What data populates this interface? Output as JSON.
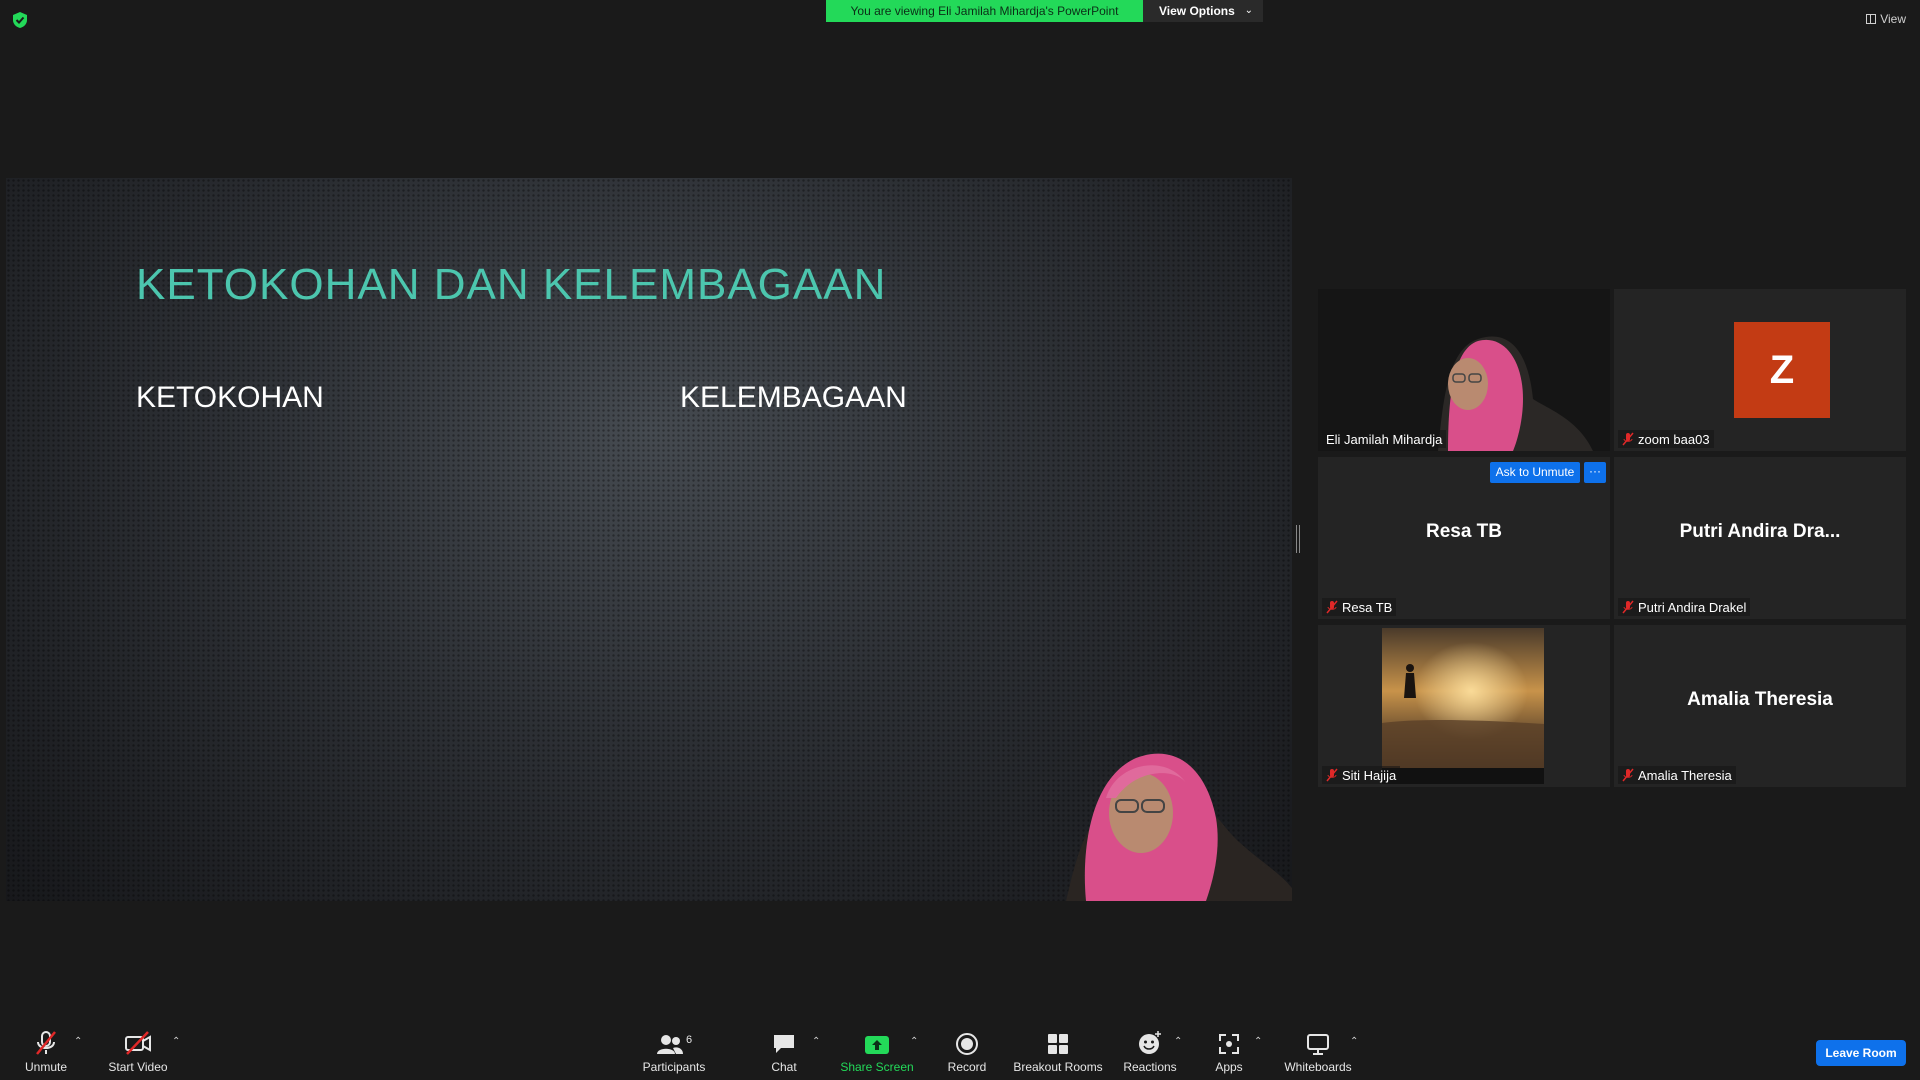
{
  "topbar": {
    "viewing_banner": "You are viewing Eli Jamilah Mihardja's PowerPoint",
    "view_options_label": "View Options",
    "view_label": "View"
  },
  "slide": {
    "title": "KETOKOHAN DAN KELEMBAGAAN",
    "col_left": "KETOKOHAN",
    "col_right": "KELEMBAGAAN"
  },
  "gallery": {
    "tiles": [
      {
        "label": "Eli Jamilah Mihardja",
        "display": "",
        "muted": false
      },
      {
        "label": "zoom baa03",
        "display": "Z",
        "muted": true
      },
      {
        "label": "Resa TB",
        "display": "Resa TB",
        "muted": true
      },
      {
        "label": "Putri Andira Drakel",
        "display": "Putri Andira Dra...",
        "muted": true
      },
      {
        "label": "Siti Hajija",
        "display": "",
        "muted": true
      },
      {
        "label": "Amalia Theresia",
        "display": "Amalia Theresia",
        "muted": true
      }
    ],
    "ask_to_unmute": "Ask to Unmute",
    "more": "···"
  },
  "toolbar": {
    "unmute": "Unmute",
    "start_video": "Start Video",
    "participants": "Participants",
    "participants_count": "6",
    "chat": "Chat",
    "share_screen": "Share Screen",
    "record": "Record",
    "breakout_rooms": "Breakout Rooms",
    "reactions": "Reactions",
    "apps": "Apps",
    "whiteboards": "Whiteboards",
    "leave_room": "Leave Room"
  },
  "colors": {
    "banner_green": "#23d959",
    "slide_title": "#4cc6ae",
    "active_speaker_border": "#d7ee7a",
    "avatar_z": "#c33b14",
    "accent_blue": "#0e71eb"
  }
}
